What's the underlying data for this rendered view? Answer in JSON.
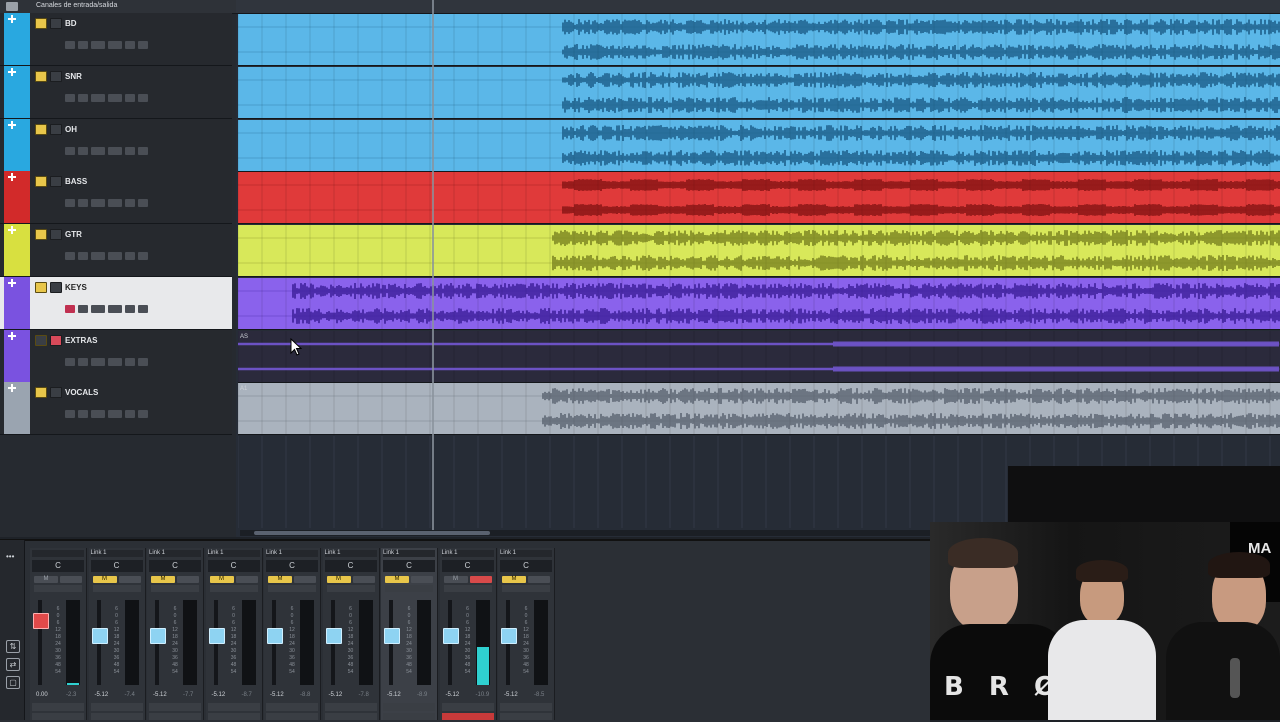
{
  "tracklist": {
    "header_title": "Canales de entrada/salida",
    "tracks": [
      {
        "name": "BD",
        "color": "#29a8e0"
      },
      {
        "name": "SNR",
        "color": "#29a8e0"
      },
      {
        "name": "OH",
        "color": "#29a8e0"
      },
      {
        "name": "BASS",
        "color": "#d22a2a"
      },
      {
        "name": "GTR",
        "color": "#d8e040"
      },
      {
        "name": "KEYS",
        "color": "#7a52e0"
      },
      {
        "name": "EXTRAS",
        "color": "#7a52e0"
      },
      {
        "name": "VOCALS",
        "color": "#9aa4b0"
      }
    ]
  },
  "arrange": {
    "lane_colors": [
      "#5bb7e8",
      "#5bb7e8",
      "#5bb7e8",
      "#e03a3a",
      "#d8e85a",
      "#8a62ec",
      "#2b2a3c",
      "#aab3be"
    ],
    "wave_colors": [
      "#1d5f8a",
      "#1d5f8a",
      "#1d5f8a",
      "#861414",
      "#7b8420",
      "#3d1f9a",
      "#7a5be0",
      "#5d6673"
    ],
    "lane_label_extras": "AS",
    "lane_label_vocals": "A1"
  },
  "mixer": {
    "strips": [
      {
        "link": "",
        "pan": "C",
        "m": false,
        "s": false,
        "value": "0.00",
        "value2": "-2.3",
        "fader": 0.82,
        "level": 0.02,
        "red": true
      },
      {
        "link": "Link 1",
        "pan": "C",
        "m": true,
        "s": false,
        "value": "-5.12",
        "value2": "-7.4",
        "fader": 0.6,
        "level": 0.0,
        "red": false
      },
      {
        "link": "Link 1",
        "pan": "C",
        "m": true,
        "s": false,
        "value": "-5.12",
        "value2": "-7.7",
        "fader": 0.6,
        "level": 0.0,
        "red": false
      },
      {
        "link": "Link 1",
        "pan": "C",
        "m": true,
        "s": false,
        "value": "-5.12",
        "value2": "-8.7",
        "fader": 0.6,
        "level": 0.0,
        "red": false
      },
      {
        "link": "Link 1",
        "pan": "C",
        "m": true,
        "s": false,
        "value": "-5.12",
        "value2": "-8.8",
        "fader": 0.6,
        "level": 0.0,
        "red": false
      },
      {
        "link": "Link 1",
        "pan": "C",
        "m": true,
        "s": false,
        "value": "-5.12",
        "value2": "-7.8",
        "fader": 0.6,
        "level": 0.0,
        "red": false
      },
      {
        "link": "Link 1",
        "pan": "C",
        "m": true,
        "s": false,
        "value": "-5.12",
        "value2": "-8.9",
        "fader": 0.6,
        "level": 0.0,
        "red": false
      },
      {
        "link": "Link 1",
        "pan": "C",
        "m": false,
        "s": true,
        "value": "-5.12",
        "value2": "-10.9",
        "fader": 0.6,
        "level": 0.45,
        "red": false
      },
      {
        "link": "Link 1",
        "pan": "C",
        "m": true,
        "s": false,
        "value": "-5.12",
        "value2": "-8.5",
        "fader": 0.6,
        "level": 0.0,
        "red": false
      }
    ],
    "scale": [
      "6",
      "0",
      "6",
      "12",
      "18",
      "24",
      "30",
      "36",
      "48",
      "54"
    ]
  },
  "webcam": {
    "shirt_text": "B R Ø",
    "sign_text": "MA"
  }
}
